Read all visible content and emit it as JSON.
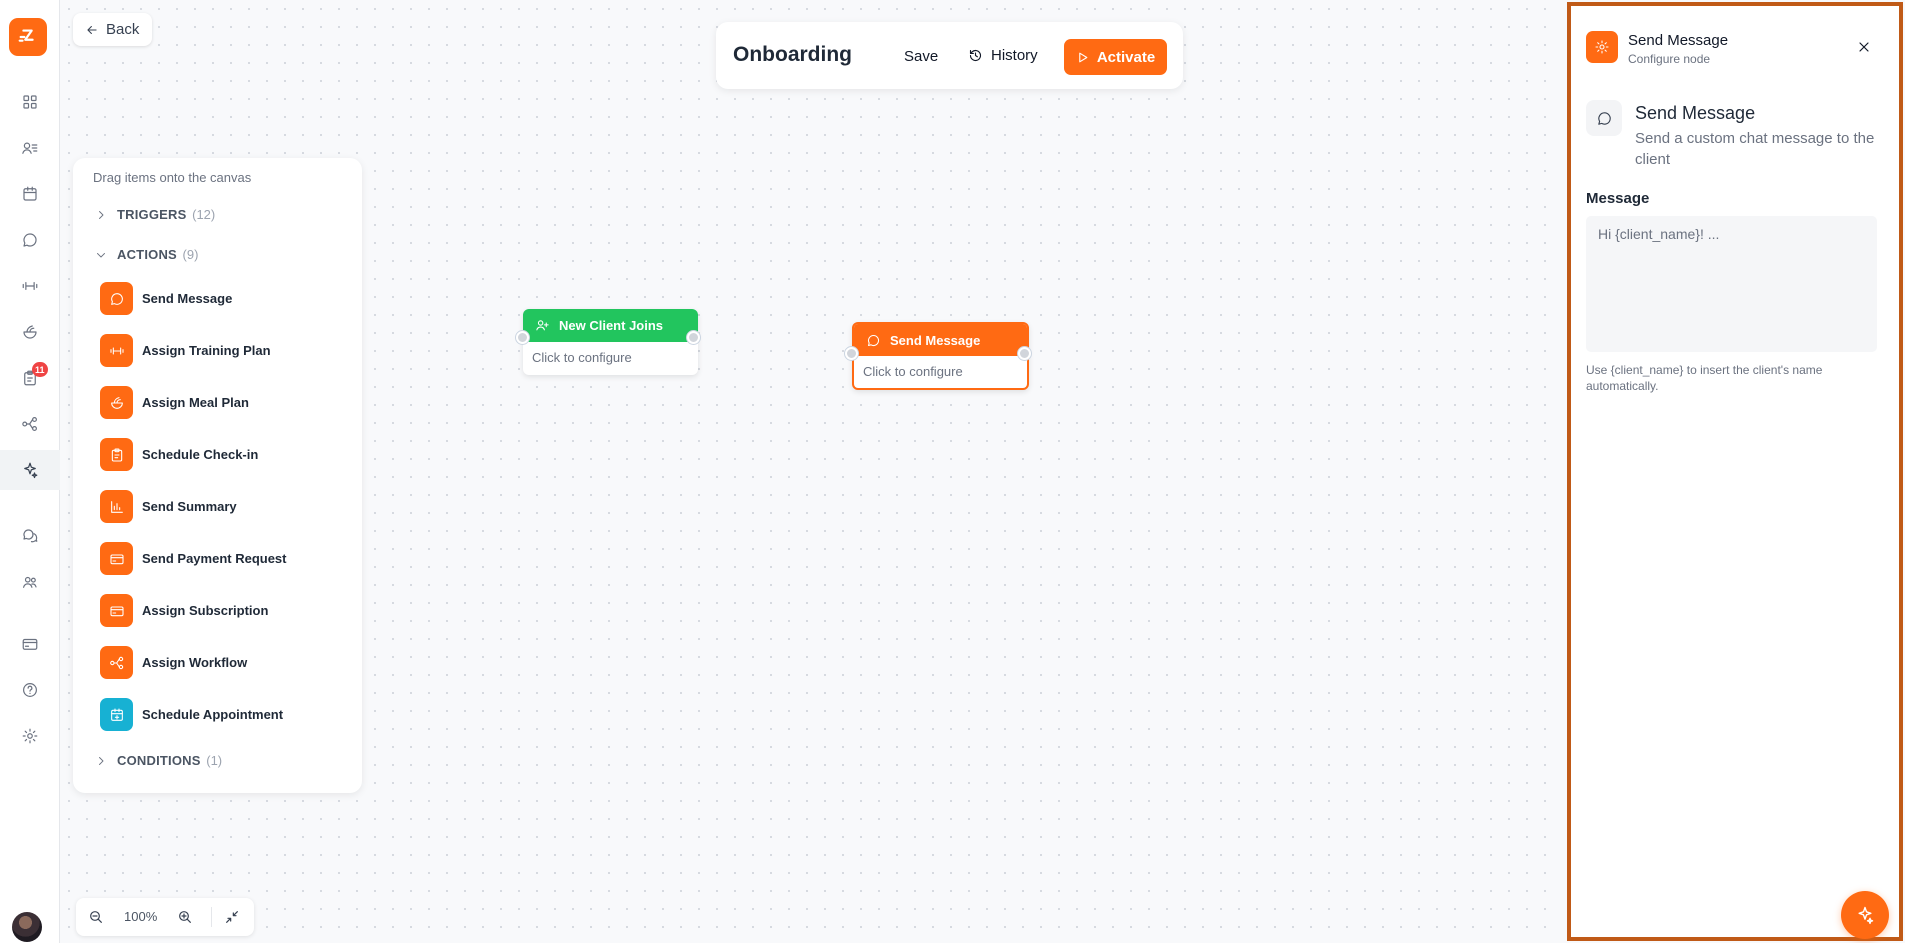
{
  "back_button": {
    "label": "Back",
    "icon": "arrow-left-icon"
  },
  "topbar": {
    "title": "Onboarding",
    "save_label": "Save",
    "history_label": "History",
    "activate_label": "Activate"
  },
  "sidebar": {
    "badge_count": "11",
    "items": [
      {
        "name": "dashboard",
        "icon": "grid-icon"
      },
      {
        "name": "clients",
        "icon": "users-list-icon"
      },
      {
        "name": "calendar",
        "icon": "calendar-icon"
      },
      {
        "name": "messages",
        "icon": "chat-icon"
      },
      {
        "name": "training",
        "icon": "dumbbell-icon"
      },
      {
        "name": "nutrition",
        "icon": "meal-icon"
      },
      {
        "name": "check-ins",
        "icon": "clipboard-icon"
      },
      {
        "name": "workflows",
        "icon": "workflow-icon"
      },
      {
        "name": "automations",
        "icon": "sparkle-icon"
      },
      {
        "name": "community",
        "icon": "chats-icon"
      },
      {
        "name": "team",
        "icon": "team-icon"
      },
      {
        "name": "billing",
        "icon": "card-icon"
      },
      {
        "name": "help",
        "icon": "help-icon"
      },
      {
        "name": "settings",
        "icon": "gear-icon"
      }
    ]
  },
  "palette": {
    "hint": "Drag items onto the canvas",
    "groups": [
      {
        "label": "TRIGGERS",
        "count": "(12)",
        "expanded": false
      },
      {
        "label": "ACTIONS",
        "count": "(9)",
        "expanded": true
      },
      {
        "label": "CONDITIONS",
        "count": "(1)",
        "expanded": false
      }
    ],
    "actions": [
      {
        "label": "Send Message",
        "icon": "chat-icon",
        "color": "#ff6a13"
      },
      {
        "label": "Assign Training Plan",
        "icon": "dumbbell-icon",
        "color": "#ff6a13"
      },
      {
        "label": "Assign Meal Plan",
        "icon": "meal-icon",
        "color": "#ff6a13"
      },
      {
        "label": "Schedule Check-in",
        "icon": "clipboard-icon",
        "color": "#ff6a13"
      },
      {
        "label": "Send Summary",
        "icon": "bar-chart-icon",
        "color": "#ff6a13"
      },
      {
        "label": "Send Payment Request",
        "icon": "card-icon",
        "color": "#ff6a13"
      },
      {
        "label": "Assign Subscription",
        "icon": "card-icon",
        "color": "#ff6a13"
      },
      {
        "label": "Assign Workflow",
        "icon": "workflow-icon",
        "color": "#ff6a13"
      },
      {
        "label": "Schedule Appointment",
        "icon": "calendar-plus-icon",
        "color": "#17b1d3"
      }
    ]
  },
  "nodes": [
    {
      "title": "New Client Joins",
      "body": "Click to configure",
      "icon": "user-plus-icon",
      "color": "#22c55e"
    },
    {
      "title": "Send Message",
      "body": "Click to configure",
      "icon": "chat-icon",
      "color": "#ff6a13",
      "selected": true
    }
  ],
  "zoom": {
    "level": "100%"
  },
  "config_panel": {
    "title": "Send Message",
    "subtitle": "Configure node",
    "node_title": "Send Message",
    "node_description": "Send a custom chat message to the client",
    "field_label": "Message",
    "field_value": "",
    "field_placeholder": "Hi {client_name}! ...",
    "field_help": "Use {client_name} to insert the client's name automatically."
  },
  "colors": {
    "accent": "#ff6a13",
    "trigger": "#22c55e",
    "panel_border": "#c05a17"
  }
}
